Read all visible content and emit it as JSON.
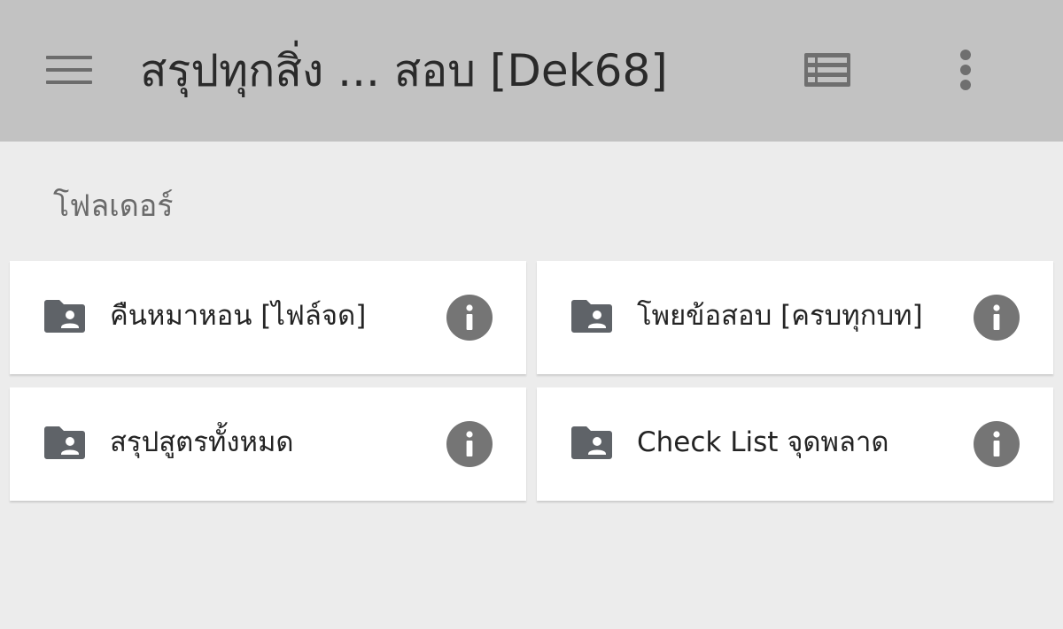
{
  "appbar": {
    "title": "สรุปทุกสิ่ง ... สอบ [Dek68]",
    "menu_icon": "menu-icon",
    "view_icon": "list-view-icon",
    "more_icon": "more-vert-icon"
  },
  "section": {
    "title": "โฟลเดอร์"
  },
  "folders": [
    {
      "name": "คืนหมาหอน [ไฟล์จด]",
      "icon": "shared-folder-icon"
    },
    {
      "name": "โพยข้อสอบ [ครบทุกบท]",
      "icon": "shared-folder-icon"
    },
    {
      "name": "สรุปสูตรทั้งหมด",
      "icon": "shared-folder-icon"
    },
    {
      "name": "Check List จุดพลาด",
      "icon": "shared-folder-icon"
    }
  ],
  "colors": {
    "appbar_bg": "#c2c2c2",
    "page_bg": "#ececec",
    "card_bg": "#ffffff",
    "icon_gray": "#5f6368",
    "info_gray": "#757575"
  }
}
